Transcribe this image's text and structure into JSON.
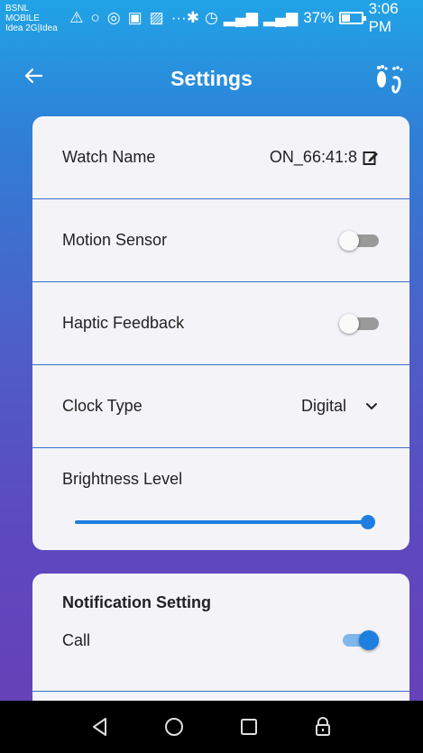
{
  "status_bar": {
    "carrier_line1": "BSNL MOBILE",
    "carrier_line2": "Idea 2G|Idea",
    "battery_percent": "37%",
    "time": "3:06 PM"
  },
  "header": {
    "title": "Settings"
  },
  "settings": {
    "watch_name_label": "Watch Name",
    "watch_name_value": "ON_66:41:8",
    "motion_sensor_label": "Motion Sensor",
    "motion_sensor_on": false,
    "haptic_feedback_label": "Haptic Feedback",
    "haptic_feedback_on": false,
    "clock_type_label": "Clock Type",
    "clock_type_value": "Digital",
    "brightness_label": "Brightness Level",
    "brightness_level": 1.0
  },
  "notifications": {
    "title": "Notification Setting",
    "call_label": "Call",
    "call_on": true
  },
  "colors": {
    "accent": "#1e7fe0",
    "divider": "#3a6fc8"
  },
  "icons": {
    "back": "arrow-left-icon",
    "steps": "footprints-icon",
    "edit": "edit-icon",
    "dropdown": "chevron-down-icon",
    "nav_back": "triangle-back-icon",
    "nav_home": "circle-home-icon",
    "nav_recent": "square-recent-icon",
    "nav_lock": "lock-icon"
  }
}
